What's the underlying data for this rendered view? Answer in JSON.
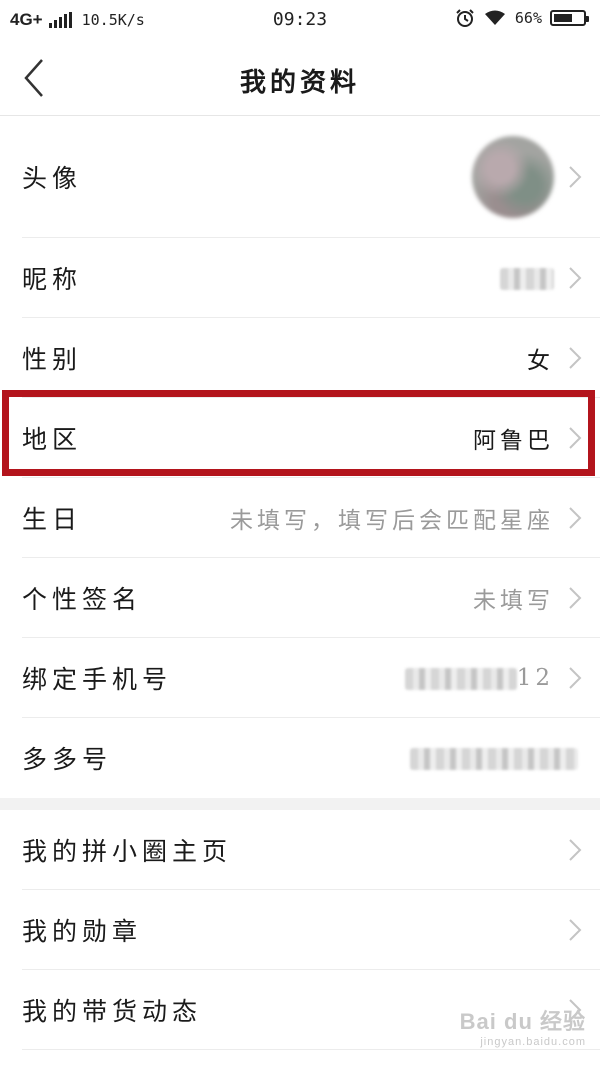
{
  "status_bar": {
    "network": "4G+",
    "speed": "10.5K/s",
    "time": "09:23",
    "battery_percent": "66%",
    "battery_level": 0.66,
    "icons": [
      "signal-icon",
      "alarm-icon",
      "wifi-icon",
      "battery-icon"
    ]
  },
  "nav": {
    "back_icon": "chevron-left-icon",
    "title": "我的资料"
  },
  "profile_rows": [
    {
      "label": "头像",
      "value": "",
      "value_kind": "avatar-blurred"
    },
    {
      "label": "昵称",
      "value": "",
      "value_kind": "blurred"
    },
    {
      "label": "性别",
      "value": "女",
      "value_kind": "text"
    },
    {
      "label": "地区",
      "value": "阿鲁巴",
      "value_kind": "text",
      "highlighted": true
    },
    {
      "label": "生日",
      "value": "未填写，填写后会匹配星座",
      "value_kind": "placeholder"
    },
    {
      "label": "个性签名",
      "value": "未填写",
      "value_kind": "placeholder"
    },
    {
      "label": "绑定手机号",
      "value": "12",
      "value_kind": "blurred-partial"
    },
    {
      "label": "多多号",
      "value": "",
      "value_kind": "blurred"
    }
  ],
  "extra_rows": [
    {
      "label": "我的拼小圈主页"
    },
    {
      "label": "我的勋章"
    },
    {
      "label": "我的带货动态"
    }
  ],
  "colors": {
    "highlight_border": "#b3141c",
    "placeholder_text": "#9a9a9a",
    "chevron": "#c4c4c4",
    "section_gap": "#f2f2f2"
  },
  "watermark": {
    "main": "Bai du 经验",
    "sub": "jingyan.baidu.com"
  }
}
